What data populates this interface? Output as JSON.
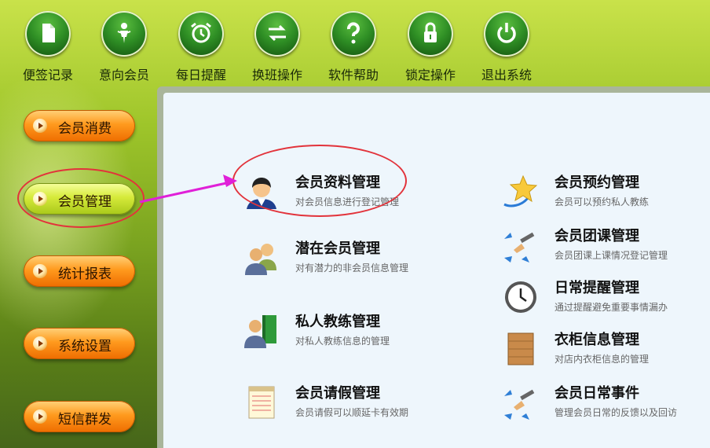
{
  "toolbar": {
    "items": [
      {
        "label": "便签记录",
        "icon": "note-icon"
      },
      {
        "label": "意向会员",
        "icon": "person-icon"
      },
      {
        "label": "每日提醒",
        "icon": "alarm-clock-icon"
      },
      {
        "label": "换班操作",
        "icon": "swap-arrows-icon"
      },
      {
        "label": "软件帮助",
        "icon": "question-icon"
      },
      {
        "label": "锁定操作",
        "icon": "lock-icon"
      },
      {
        "label": "退出系统",
        "icon": "power-icon"
      }
    ]
  },
  "sidebar": {
    "items": [
      {
        "label": "会员消费",
        "active": false
      },
      {
        "label": "会员管理",
        "active": true
      },
      {
        "label": "统计报表",
        "active": false
      },
      {
        "label": "系统设置",
        "active": false
      },
      {
        "label": "短信群发",
        "active": false
      }
    ]
  },
  "main": {
    "left": [
      {
        "title": "会员资料管理",
        "desc": "对会员信息进行登记管理",
        "icon": "member-avatar-icon"
      },
      {
        "title": "潜在会员管理",
        "desc": "对有潜力的非会员信息管理",
        "icon": "users-group-icon"
      },
      {
        "title": "私人教练管理",
        "desc": "对私人教练信息的管理",
        "icon": "trainer-book-icon"
      },
      {
        "title": "会员请假管理",
        "desc": "会员请假可以顺延卡有效期",
        "icon": "notepad-icon"
      }
    ],
    "right": [
      {
        "title": "会员预约管理",
        "desc": "会员可以预约私人教练",
        "icon": "star-icon"
      },
      {
        "title": "会员团课管理",
        "desc": "会员团课上课情况登记管理",
        "icon": "pen-arrows-icon"
      },
      {
        "title": "日常提醒管理",
        "desc": "通过提醒避免重要事情漏办",
        "icon": "clock-icon"
      },
      {
        "title": "衣柜信息管理",
        "desc": "对店内衣柜信息的管理",
        "icon": "cabinet-icon"
      },
      {
        "title": "会员日常事件",
        "desc": "管理会员日常的反馈以及回访",
        "icon": "pen-arrows-icon"
      }
    ]
  },
  "colors": {
    "highlight_ring": "#e2333b",
    "pointer_arrow": "#e020d8",
    "panel_bg": "#eef6fc"
  }
}
